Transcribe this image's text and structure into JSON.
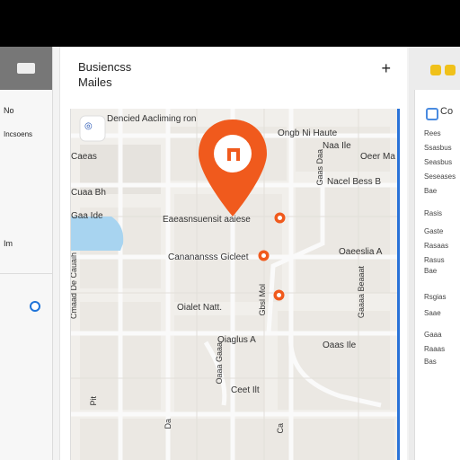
{
  "left_rail": {
    "items": [
      {
        "label": "No"
      },
      {
        "label": "Incsoens"
      },
      {
        "label": "Im"
      }
    ]
  },
  "header": {
    "title_line1": "Busiencss",
    "title_line2": "Mailes",
    "add_label": "+"
  },
  "map": {
    "search_label": "Dencied Aacliming ron",
    "labels": [
      {
        "text": "Ongb Ni Haute"
      },
      {
        "text": "Naa Ile"
      },
      {
        "text": "Oeer Ma"
      },
      {
        "text": "Nacel Bess B"
      },
      {
        "text": "Caeas"
      },
      {
        "text": "Cuaa Bh"
      },
      {
        "text": "Gaa Ide"
      },
      {
        "text": "Eaeasnsuensit aaiese"
      },
      {
        "text": "Cananansss Gicleet"
      },
      {
        "text": "Oaeeslia A"
      },
      {
        "text": "Oialet Natt."
      },
      {
        "text": "Oiaglus A"
      },
      {
        "text": "Oaas Ile"
      },
      {
        "text": "Ceet Ilt"
      }
    ],
    "vertical_labels": [
      {
        "text": "Cmaad De Cauaih"
      },
      {
        "text": "Gaas Daa"
      },
      {
        "text": "Gaaaa Beaaat"
      },
      {
        "text": "Gbsl Mol"
      },
      {
        "text": "Oaaa Gaaa"
      }
    ],
    "bottom_labels": [
      {
        "text": "Pit"
      },
      {
        "text": "Da"
      },
      {
        "text": "Ca"
      }
    ]
  },
  "right_panel": {
    "header": "Co",
    "lines": [
      {
        "text": "Rees"
      },
      {
        "text": "Ssasbus"
      },
      {
        "text": "Seasbus"
      },
      {
        "text": "Seseases"
      },
      {
        "text": "Bae"
      },
      {
        "text": "Rasis"
      },
      {
        "text": "Gaste"
      },
      {
        "text": "Rasaas"
      },
      {
        "text": "Rasus"
      },
      {
        "text": "Bae"
      },
      {
        "text": "Rsgias"
      },
      {
        "text": "Saae"
      },
      {
        "text": "Gaaa"
      },
      {
        "text": "Raaas"
      },
      {
        "text": "Bas"
      }
    ]
  },
  "colors": {
    "accent_pin": "#f05a1d",
    "water": "#a8d4f0",
    "selection": "#1e73d8"
  }
}
